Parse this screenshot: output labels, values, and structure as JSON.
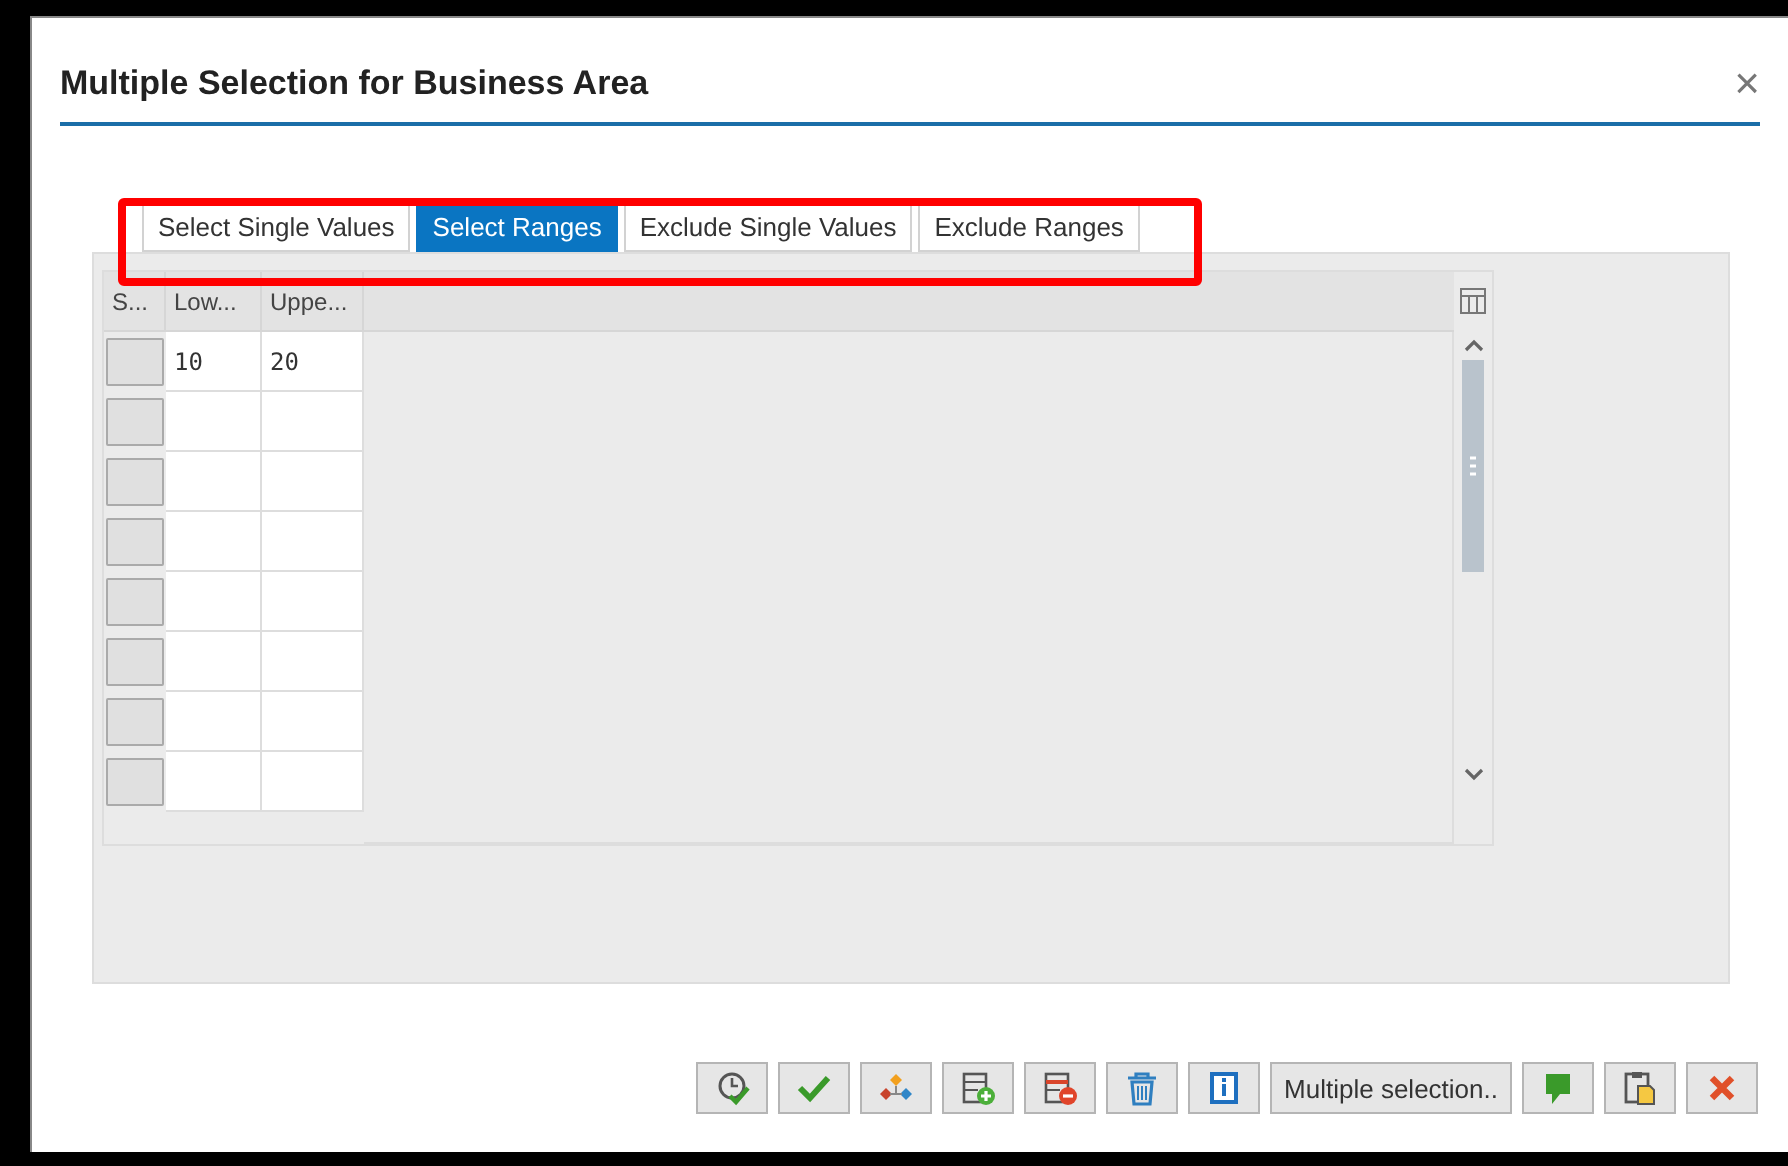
{
  "dialog": {
    "title": "Multiple Selection for Business Area",
    "close": "×"
  },
  "tabs": [
    {
      "label": "Select Single Values",
      "selected": false
    },
    {
      "label": "Select Ranges",
      "selected": true
    },
    {
      "label": "Exclude Single Values",
      "selected": false
    },
    {
      "label": "Exclude Ranges",
      "selected": false
    }
  ],
  "table": {
    "columns": [
      "S...",
      "Low...",
      "Uppe..."
    ],
    "rows": [
      {
        "low": "10",
        "upper": "20"
      }
    ]
  },
  "toolbar": [
    {
      "kind": "icon"
    },
    {
      "kind": "icon"
    },
    {
      "kind": "icon"
    },
    {
      "kind": "icon"
    },
    {
      "kind": "icon"
    },
    {
      "kind": "icon"
    },
    {
      "kind": "icon"
    },
    {
      "kind": "text",
      "label": "Multiple selection.."
    },
    {
      "kind": "icon"
    },
    {
      "kind": "icon"
    },
    {
      "kind": "icon"
    }
  ]
}
